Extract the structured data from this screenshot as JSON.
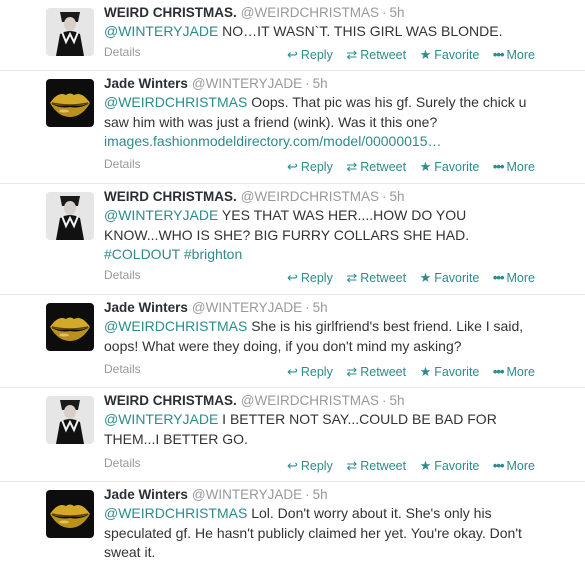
{
  "tweets": [
    {
      "user": "weird",
      "fullname": "WEIRD CHRISTMAS.",
      "handle": "@WEIRDCHRISTMAS",
      "time": "5h",
      "mention": "@WINTERYJADE",
      "body": " NO…IT WASN`T. THIS GIRL WAS BLONDE.",
      "details": "Details"
    },
    {
      "user": "jade",
      "fullname": "Jade Winters",
      "handle": "@WINTERYJADE",
      "time": "5h",
      "mention": "@WEIRDCHRISTMAS",
      "body": " Oops. That pic was his gf. Surely the chick u saw him with was just a friend (wink). Was it this one?",
      "link": "images.fashionmodeldirectory.com/model/00000015…",
      "details": "Details"
    },
    {
      "user": "weird",
      "fullname": "WEIRD CHRISTMAS.",
      "handle": "@WEIRDCHRISTMAS",
      "time": "5h",
      "mention": "@WINTERYJADE",
      "body": " YES THAT WAS HER....HOW DO YOU KNOW...WHO IS SHE? BIG FURRY COLLARS SHE HAD.",
      "hashtag1": "#COLDOUT",
      "hashtag2": "#brighton",
      "details": "Details"
    },
    {
      "user": "jade",
      "fullname": "Jade Winters",
      "handle": "@WINTERYJADE",
      "time": "5h",
      "mention": "@WEIRDCHRISTMAS",
      "body": " She is his girlfriend's best friend. Like I said, oops! What were they doing, if you don't mind my asking?",
      "details": "Details"
    },
    {
      "user": "weird",
      "fullname": "WEIRD CHRISTMAS.",
      "handle": "@WEIRDCHRISTMAS",
      "time": "5h",
      "mention": "@WINTERYJADE",
      "body": " I BETTER NOT SAY...COULD BE BAD FOR THEM...I BETTER GO.",
      "details": "Details"
    },
    {
      "user": "jade",
      "fullname": "Jade Winters",
      "handle": "@WINTERYJADE",
      "time": "5h",
      "mention": "@WEIRDCHRISTMAS",
      "body": " Lol. Don't worry about it. She's only his speculated gf. He hasn't publicly claimed her yet. You're okay. Don't sweat it."
    }
  ],
  "actions": {
    "reply": "Reply",
    "retweet": "Retweet",
    "favorite": "Favorite",
    "more": "More",
    "reply_icon": "reply-arrow-icon",
    "retweet_icon": "retweet-arrows-icon",
    "favorite_icon": "star-icon",
    "more_icon": "ellipsis-dots-icon"
  },
  "colors": {
    "link": "#2e8b8b",
    "muted": "#999999",
    "divider": "#e8e8e8",
    "lips_gold": "#c9a227"
  }
}
